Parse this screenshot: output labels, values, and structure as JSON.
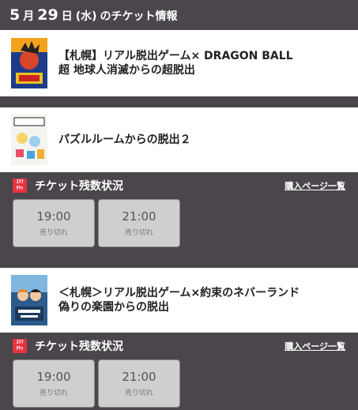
{
  "header": {
    "month": "5",
    "month_unit": "月",
    "day": "29",
    "day_unit": "日",
    "weekday": "(水)",
    "suffix": "のチケット情報"
  },
  "events": [
    {
      "title_line1": "【札幌】リアル脱出ゲーム× DRAGON BALL",
      "title_line2": "超 地球人消滅からの超脱出",
      "thumb_icon": "dragonball-poster-icon"
    },
    {
      "title_line1": "パズルルームからの脱出２",
      "title_line2": "",
      "thumb_icon": "puzzle-room-poster-icon"
    },
    {
      "title_line1": "＜札幌＞リアル脱出ゲーム×約束のネバーランド",
      "title_line2": "偽りの楽園からの脱出",
      "thumb_icon": "neverland-poster-icon"
    }
  ],
  "ticket_sections": [
    {
      "logo_top": "ｽｸﾗ",
      "logo_bottom": "ﾁｹｯ",
      "title": "チケット残数状況",
      "link": "購入ページ一覧",
      "slots": [
        {
          "time": "19:00",
          "status": "売り切れ"
        },
        {
          "time": "21:00",
          "status": "売り切れ"
        }
      ]
    },
    {
      "logo_top": "ｽｸﾗ",
      "logo_bottom": "ﾁｹｯ",
      "title": "チケット残数状況",
      "link": "購入ページ一覧",
      "slots": [
        {
          "time": "19:00",
          "status": "売り切れ"
        },
        {
          "time": "21:00",
          "status": "売り切れ"
        }
      ]
    }
  ],
  "colors": {
    "background": "#4a464b",
    "card": "#ffffff",
    "logo_red": "#e8333f",
    "slot_bg": "#cfcfcf"
  }
}
